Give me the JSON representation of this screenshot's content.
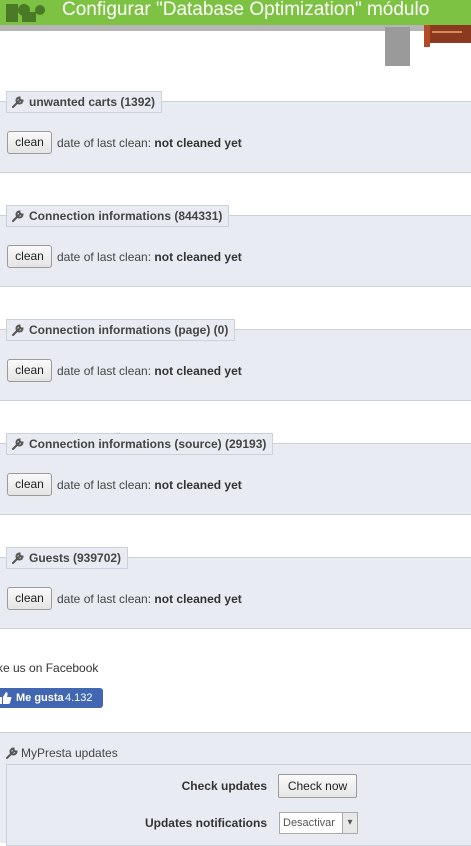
{
  "header": {
    "title": "Configurar \"Database Optimization\" módulo"
  },
  "clean_status": {
    "prefix": "date of last clean:",
    "value": "not cleaned yet"
  },
  "clean_label": "clean",
  "sections": [
    {
      "title": "unwanted carts (1392)"
    },
    {
      "title": "Connection informations (844331)"
    },
    {
      "title": "Connection informations (page) (0)"
    },
    {
      "title": "Connection informations (source) (29193)"
    },
    {
      "title": "Guests (939702)"
    }
  ],
  "facebook": {
    "text": "ke us on Facebook",
    "like_label": "Me gusta",
    "like_count": "4.132"
  },
  "updates": {
    "title": "MyPresta updates",
    "check_label": "Check updates",
    "check_button": "Check now",
    "notifications_label": "Updates notifications",
    "notifications_value": "Desactivar"
  },
  "colors": {
    "brand_green": "#7dc243",
    "facebook_blue": "#4267b2",
    "panel_bg": "#e8ecf2"
  }
}
